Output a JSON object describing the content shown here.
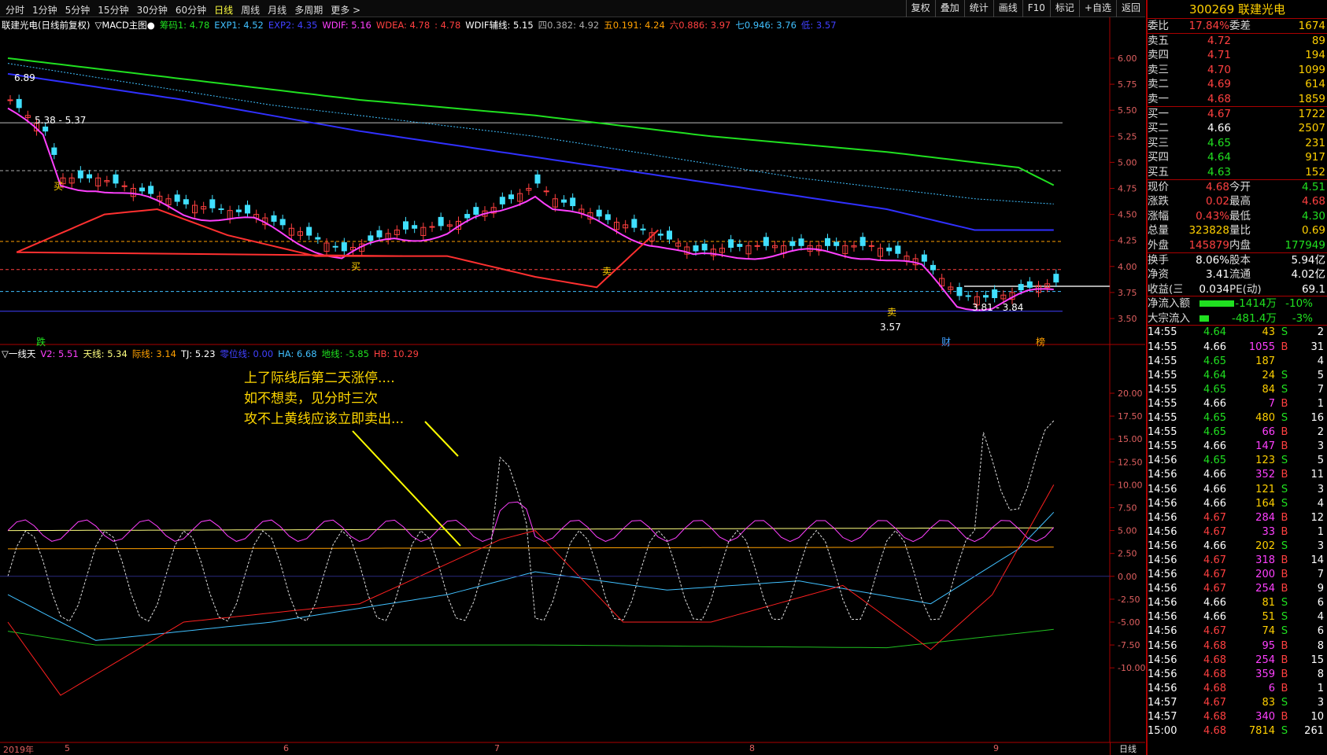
{
  "toolbar": {
    "periods": [
      "分时",
      "1分钟",
      "5分钟",
      "15分钟",
      "30分钟",
      "60分钟",
      "日线",
      "周线",
      "月线",
      "多周期",
      "更多 >"
    ],
    "active_period": "日线",
    "tools": [
      "复权",
      "叠加",
      "统计",
      "画线",
      "F10",
      "标记",
      "+自选",
      "返回"
    ]
  },
  "main_legend": {
    "name": "联建光电(日线前复权)",
    "indicator": "▽MACD主图●",
    "items": [
      {
        "text": "筹码1: 4.78",
        "color": "#20e020"
      },
      {
        "text": "EXP1: 4.52",
        "color": "#40c0ff"
      },
      {
        "text": "EXP2: 4.35",
        "color": "#4040ff"
      },
      {
        "text": "WDIF: 5.16",
        "color": "#ff40ff"
      },
      {
        "text": "WDEA: 4.78",
        "color": "#ff4040"
      },
      {
        "text": ": 4.78",
        "color": "#ff4040"
      },
      {
        "text": "WDIF辅线: 5.15",
        "color": "#ffffff"
      },
      {
        "text": "四0.382: 4.92",
        "color": "#aaaaaa"
      },
      {
        "text": "五0.191: 4.24",
        "color": "#ffa000"
      },
      {
        "text": "六0.886: 3.97",
        "color": "#ff4040"
      },
      {
        "text": "七0.946: 3.76",
        "color": "#40c0ff"
      },
      {
        "text": "低: 3.57",
        "color": "#4040ff"
      }
    ]
  },
  "sub_legend": {
    "name": "▽一线天",
    "items": [
      {
        "text": "V2: 5.51",
        "color": "#ff40ff"
      },
      {
        "text": "天线: 5.34",
        "color": "#ffff80"
      },
      {
        "text": "际线: 3.14",
        "color": "#ffa000"
      },
      {
        "text": "TJ: 5.23",
        "color": "#ffffff"
      },
      {
        "text": "零位线: 0.00",
        "color": "#4040ff"
      },
      {
        "text": "HA: 6.68",
        "color": "#40c0ff"
      },
      {
        "text": "地线: -5.85",
        "color": "#20e020"
      },
      {
        "text": "HB: 10.29",
        "color": "#ff4040"
      }
    ]
  },
  "price_axis": [
    "6.00",
    "5.75",
    "5.50",
    "5.25",
    "5.00",
    "4.75",
    "4.50",
    "4.25",
    "4.00",
    "3.75",
    "3.50"
  ],
  "ind_axis": [
    "20.00",
    "17.50",
    "15.00",
    "12.50",
    "10.00",
    "7.50",
    "5.00",
    "2.50",
    "0.00",
    "-2.50",
    "-5.00",
    "-7.50",
    "-10.00"
  ],
  "date_labels": [
    "2019年",
    "5",
    "6",
    "7",
    "8",
    "9"
  ],
  "day_label": "日线",
  "annotation": [
    "上了际线后第二天涨停....",
    "如不想卖，见分时三次",
    "攻不上黄线应该立即卖出..."
  ],
  "markers": {
    "high": "6.89",
    "mid": "5.38 - 5.37",
    "low": "3.57",
    "low2": "3.81 - 3.84",
    "buy": "买",
    "sell": "卖",
    "fall": "跌",
    "cai": "财",
    "bang": "榜"
  },
  "quote": {
    "code_name": "300269 联建光电",
    "weibi": {
      "l1": "委比",
      "v1": "17.84%",
      "l2": "委差",
      "v2": "1674"
    },
    "asks": [
      {
        "l": "卖五",
        "p": "4.72",
        "v": "89"
      },
      {
        "l": "卖四",
        "p": "4.71",
        "v": "194"
      },
      {
        "l": "卖三",
        "p": "4.70",
        "v": "1099"
      },
      {
        "l": "卖二",
        "p": "4.69",
        "v": "614"
      },
      {
        "l": "卖一",
        "p": "4.68",
        "v": "1859"
      }
    ],
    "bids": [
      {
        "l": "买一",
        "p": "4.67",
        "v": "1722"
      },
      {
        "l": "买二",
        "p": "4.66",
        "v": "2507"
      },
      {
        "l": "买三",
        "p": "4.65",
        "v": "231"
      },
      {
        "l": "买四",
        "p": "4.64",
        "v": "917"
      },
      {
        "l": "买五",
        "p": "4.63",
        "v": "152"
      }
    ],
    "stats1": [
      {
        "l1": "现价",
        "v1": "4.68",
        "l2": "今开",
        "v2": "4.51"
      },
      {
        "l1": "涨跌",
        "v1": "0.02",
        "l2": "最高",
        "v2": "4.68"
      },
      {
        "l1": "涨幅",
        "v1": "0.43%",
        "l2": "最低",
        "v2": "4.30"
      },
      {
        "l1": "总量",
        "v1": "323828",
        "l2": "量比",
        "v2": "0.69"
      },
      {
        "l1": "外盘",
        "v1": "145879",
        "l2": "内盘",
        "v2": "177949"
      }
    ],
    "stats2": [
      {
        "l1": "换手",
        "v1": "8.06%",
        "l2": "股本",
        "v2": "5.94亿"
      },
      {
        "l1": "净资",
        "v1": "3.41",
        "l2": "流通",
        "v2": "4.02亿"
      },
      {
        "l1": "收益(三)",
        "v1": "0.034",
        "l2": "PE(动)",
        "v2": "69.1"
      }
    ],
    "flows": [
      {
        "l": "净流入额",
        "v": "-1414万",
        "p": "-10%"
      },
      {
        "l": "大宗流入",
        "v": "-481.4万",
        "p": "-3%"
      }
    ]
  },
  "ticks": [
    [
      "14:55",
      "4.64",
      "43",
      "S",
      "2"
    ],
    [
      "14:55",
      "4.66",
      "1055",
      "B",
      "31"
    ],
    [
      "14:55",
      "4.65",
      "187",
      "",
      "4"
    ],
    [
      "14:55",
      "4.64",
      "24",
      "S",
      "5"
    ],
    [
      "14:55",
      "4.65",
      "84",
      "S",
      "7"
    ],
    [
      "14:55",
      "4.66",
      "7",
      "B",
      "1"
    ],
    [
      "14:55",
      "4.65",
      "480",
      "S",
      "16"
    ],
    [
      "14:55",
      "4.65",
      "66",
      "B",
      "2"
    ],
    [
      "14:55",
      "4.66",
      "147",
      "B",
      "3"
    ],
    [
      "14:56",
      "4.65",
      "123",
      "S",
      "5"
    ],
    [
      "14:56",
      "4.66",
      "352",
      "B",
      "11"
    ],
    [
      "14:56",
      "4.66",
      "121",
      "S",
      "3"
    ],
    [
      "14:56",
      "4.66",
      "164",
      "S",
      "4"
    ],
    [
      "14:56",
      "4.67",
      "284",
      "B",
      "12"
    ],
    [
      "14:56",
      "4.67",
      "33",
      "B",
      "1"
    ],
    [
      "14:56",
      "4.66",
      "202",
      "S",
      "3"
    ],
    [
      "14:56",
      "4.67",
      "318",
      "B",
      "14"
    ],
    [
      "14:56",
      "4.67",
      "200",
      "B",
      "7"
    ],
    [
      "14:56",
      "4.67",
      "254",
      "B",
      "9"
    ],
    [
      "14:56",
      "4.66",
      "81",
      "S",
      "6"
    ],
    [
      "14:56",
      "4.66",
      "51",
      "S",
      "4"
    ],
    [
      "14:56",
      "4.67",
      "74",
      "S",
      "6"
    ],
    [
      "14:56",
      "4.68",
      "95",
      "B",
      "8"
    ],
    [
      "14:56",
      "4.68",
      "254",
      "B",
      "15"
    ],
    [
      "14:56",
      "4.68",
      "359",
      "B",
      "8"
    ],
    [
      "14:56",
      "4.68",
      "6",
      "B",
      "1"
    ],
    [
      "14:57",
      "4.67",
      "83",
      "S",
      "3"
    ],
    [
      "14:57",
      "4.68",
      "340",
      "B",
      "10"
    ],
    [
      "15:00",
      "4.68",
      "7814",
      "S",
      "261"
    ]
  ]
}
